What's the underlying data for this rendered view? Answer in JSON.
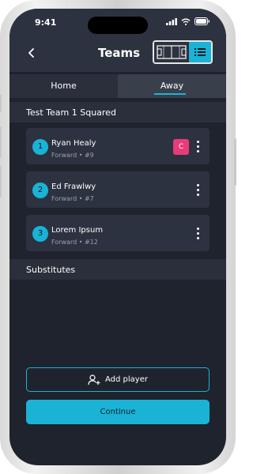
{
  "status_bar": {
    "time": "9:41"
  },
  "header": {
    "title": "Teams",
    "view_mode": "list"
  },
  "tabs": [
    {
      "label": "Home",
      "active": false
    },
    {
      "label": "Away",
      "active": true
    }
  ],
  "team": {
    "name": "Test Team 1 Squared"
  },
  "players": [
    {
      "number": "1",
      "name": "Ryan Healy",
      "position_label": "Forward • #9",
      "captain_badge": "C"
    },
    {
      "number": "2",
      "name": "Ed Frawlwy",
      "position_label": "Forward • #7"
    },
    {
      "number": "3",
      "name": "Lorem Ipsum",
      "position_label": "Forward • #12"
    }
  ],
  "substitutes": {
    "title": "Substitutes"
  },
  "actions": {
    "add_player": "Add player",
    "continue": "Continue"
  },
  "colors": {
    "accent": "#1ab3d6",
    "captain": "#e83b7a",
    "background": "#1f232e",
    "card": "#2d3240"
  }
}
